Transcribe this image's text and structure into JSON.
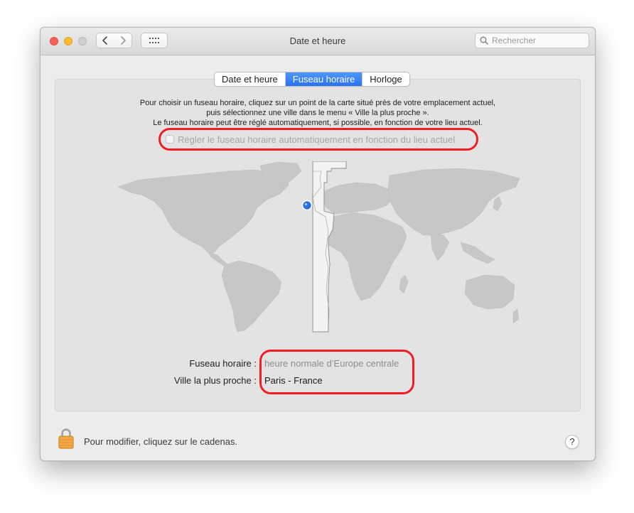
{
  "window": {
    "title": "Date et heure"
  },
  "search": {
    "placeholder": "Rechercher"
  },
  "tabs": [
    {
      "label": "Date et heure",
      "active": false
    },
    {
      "label": "Fuseau horaire",
      "active": true
    },
    {
      "label": "Horloge",
      "active": false
    }
  ],
  "instructions": {
    "line1": "Pour choisir un fuseau horaire, cliquez sur un point de la carte situé près de votre emplacement actuel,",
    "line2": "puis sélectionnez une ville dans le menu « Ville la plus proche ».",
    "line3": "Le fuseau horaire peut être réglé automatiquement, si possible, en fonction de votre lieu actuel."
  },
  "auto_timezone": {
    "label": "Régler le fuseau horaire automatiquement en fonction du lieu actuel",
    "checked": false,
    "enabled": false
  },
  "timezone": {
    "label": "Fuseau horaire :",
    "value": "heure normale d’Europe centrale"
  },
  "closest_city": {
    "label": "Ville la plus proche :",
    "value": "Paris - France"
  },
  "footer": {
    "lock_text": "Pour modifier, cliquez sur le cadenas.",
    "help_label": "?"
  },
  "colors": {
    "accent": "#2b72f0",
    "highlight_ring": "#f01d23",
    "map_land": "#c7c7c7",
    "timezone_band": "#f3f3f3",
    "location_pin": "#2b6fdc"
  },
  "icons": [
    "chevron-left-icon",
    "chevron-right-icon",
    "grid-icon",
    "search-icon",
    "lock-icon",
    "location-pin-icon"
  ]
}
